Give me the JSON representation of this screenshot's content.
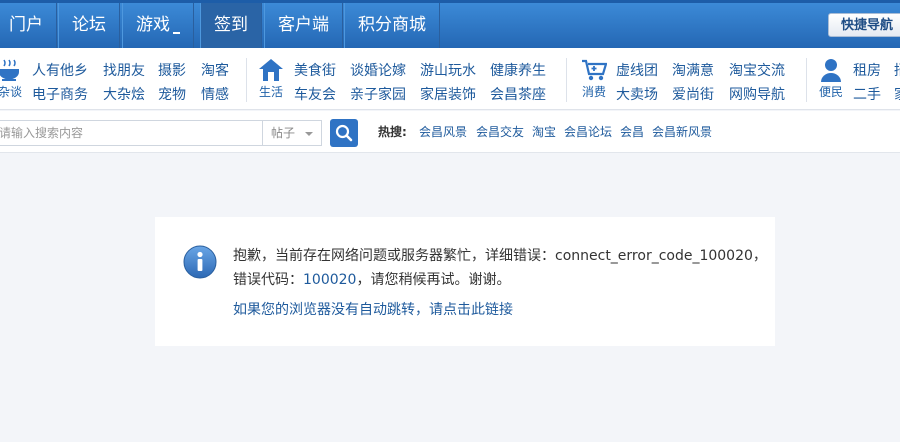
{
  "topnav": {
    "items": [
      {
        "label": "门户"
      },
      {
        "label": "论坛"
      },
      {
        "label": "游戏"
      },
      {
        "label": "签到"
      },
      {
        "label": "客户端"
      },
      {
        "label": "积分商城"
      }
    ],
    "quick_nav": "快捷导航"
  },
  "categories": {
    "groups": [
      {
        "label": "杂谈",
        "icon": "teacup-icon"
      },
      {
        "label": "生活",
        "icon": "house-icon"
      },
      {
        "label": "消费",
        "icon": "cart-icon"
      },
      {
        "label": "便民",
        "icon": "person-icon"
      }
    ],
    "links": [
      [
        "人有他乡",
        "电子商务"
      ],
      [
        "找朋友",
        "大杂烩"
      ],
      [
        "摄影",
        "宠物"
      ],
      [
        "淘客",
        "情感"
      ],
      [
        "美食街",
        "车友会"
      ],
      [
        "谈婚论嫁",
        "亲子家园"
      ],
      [
        "游山玩水",
        "家居装饰"
      ],
      [
        "健康养生",
        "会昌茶座"
      ],
      [
        "虚线团",
        "大卖场"
      ],
      [
        "淘满意",
        "爱尚街"
      ],
      [
        "淘宝交流",
        "网购导航"
      ],
      [
        "租房",
        "二手"
      ],
      [
        "招",
        "家"
      ]
    ]
  },
  "search": {
    "placeholder": "请输入搜索内容",
    "type": "帖子",
    "hot_label": "热搜:",
    "hot_links": [
      "会昌风景",
      "会昌交友",
      "淘宝",
      "会昌论坛",
      "会昌",
      "会昌新风景"
    ]
  },
  "message": {
    "line1": "抱歉，当前存在网络问题或服务器繁忙，详细错误：connect_error_code_100020，",
    "line2_prefix": "错误代码：",
    "line2_code": "100020",
    "line2_suffix": "，请您稍候再试。谢谢。",
    "redirect": "如果您的浏览器没有自动跳转，请点击此链接"
  },
  "colors": {
    "nav_blue": "#2467b4",
    "link_blue": "#1e5a9c",
    "info_blue": "#3a78c2"
  }
}
